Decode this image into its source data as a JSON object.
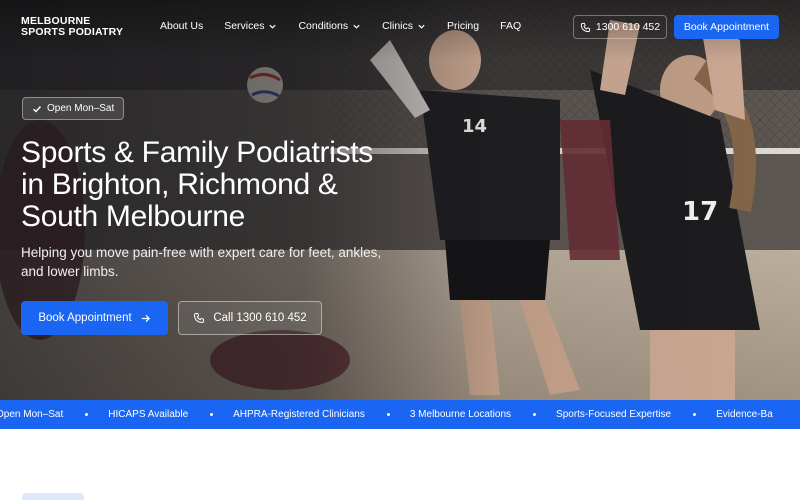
{
  "brand": {
    "line1": "MELBOURNE",
    "line2": "SPORTS PODIATRY"
  },
  "nav": {
    "items": [
      {
        "label": "About Us",
        "dropdown": false
      },
      {
        "label": "Services",
        "dropdown": true
      },
      {
        "label": "Conditions",
        "dropdown": true
      },
      {
        "label": "Clinics",
        "dropdown": true
      },
      {
        "label": "Pricing",
        "dropdown": false
      },
      {
        "label": "FAQ",
        "dropdown": false
      }
    ],
    "phone_label": "1300 610 452",
    "book_label": "Book Appointment"
  },
  "hero": {
    "badge": "Open Mon–Sat",
    "title_line1": "Sports & Family Podiatrists",
    "title_line2": "in Brighton, Richmond &",
    "title_line3": "South Melbourne",
    "subtitle_line1": "Helping you move pain-free with expert care for feet, ankles,",
    "subtitle_line2": "and lower limbs.",
    "cta_primary": "Book Appointment",
    "cta_secondary": "Call 1300 610 452",
    "jersey_left": "14",
    "jersey_right": "17"
  },
  "ticker": {
    "items": [
      "Open Mon–Sat",
      "HICAPS Available",
      "AHPRA-Registered Clinicians",
      "3 Melbourne Locations",
      "Sports-Focused Expertise",
      "Evidence-Ba"
    ]
  },
  "colors": {
    "accent": "#1a66f2",
    "ticker_bg": "#1a66f2",
    "hero_text": "#ffffff"
  },
  "icons": {
    "check": "check-icon",
    "phone": "phone-icon",
    "arrow": "arrow-right-icon",
    "chevron": "chevron-down-icon"
  }
}
